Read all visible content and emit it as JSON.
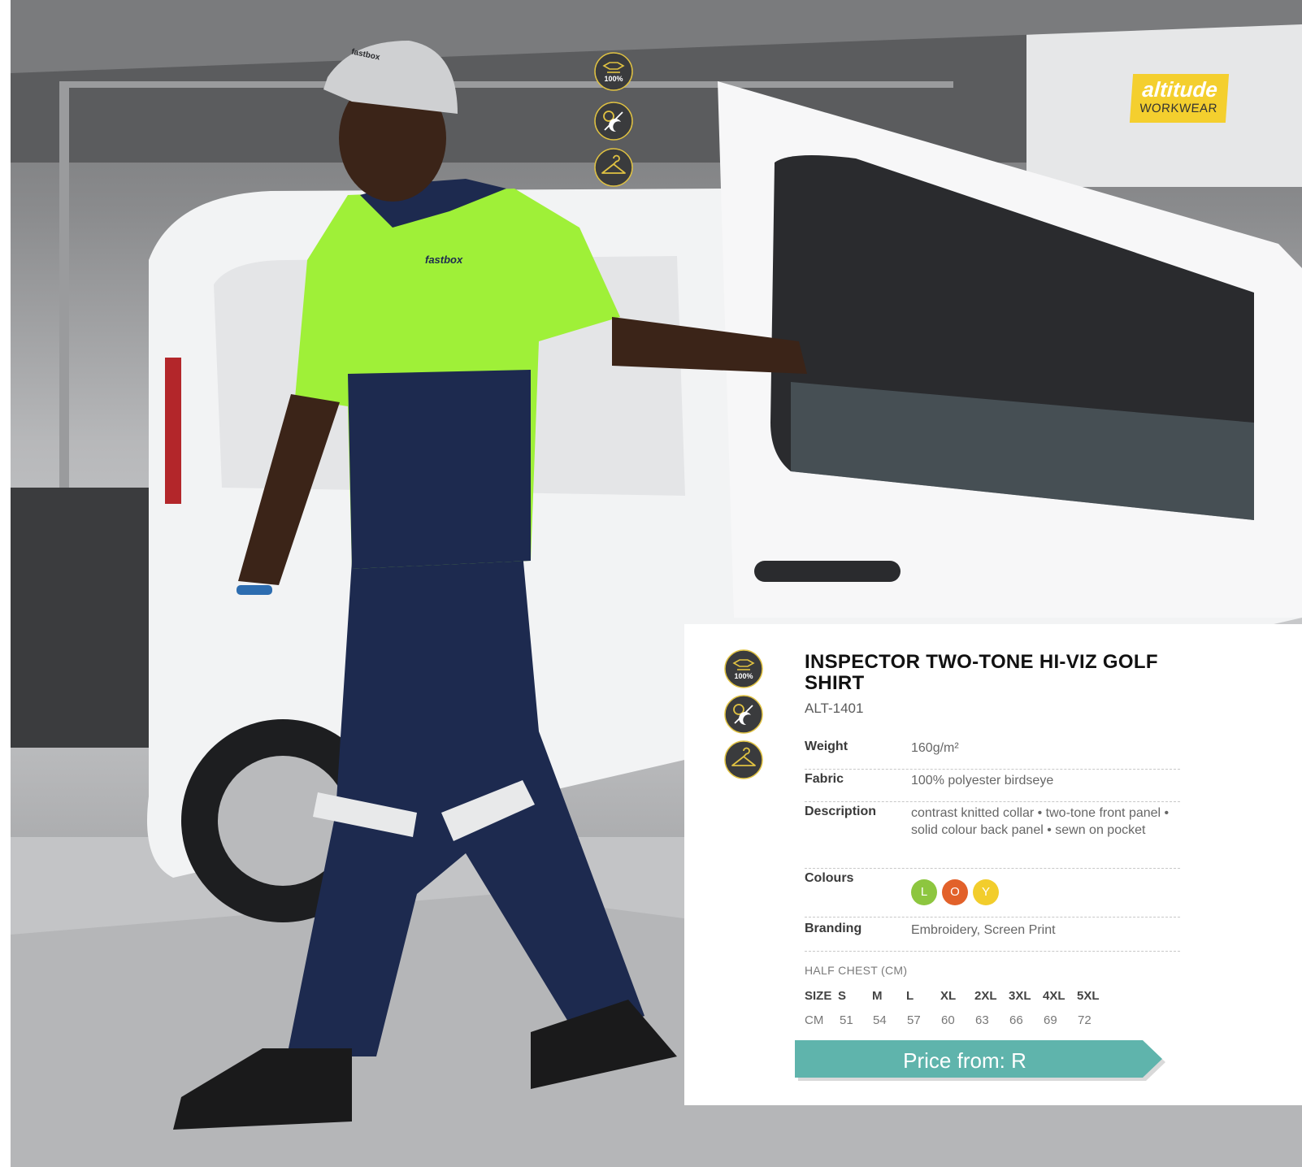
{
  "brand": {
    "logo_top": "altitude",
    "logo_bottom": "WORKWEAR",
    "color": "#f4cf2e"
  },
  "photo_features": [
    {
      "icon": "fabric-100-percent-icon",
      "label": "100%"
    },
    {
      "icon": "sun-moon-icon",
      "label": ""
    },
    {
      "icon": "hanger-icon",
      "label": ""
    }
  ],
  "product": {
    "title": "INSPECTOR TWO-TONE HI-VIZ GOLF SHIRT",
    "code": "ALT-1401",
    "specs": {
      "weight": {
        "label": "Weight",
        "value": "160g/m²"
      },
      "fabric": {
        "label": "Fabric",
        "value": "100% polyester birdseye"
      },
      "description": {
        "label": "Description",
        "value": "contrast knitted collar • two-tone front panel • solid colour back panel • sewn on pocket"
      },
      "colours": {
        "label": "Colours"
      },
      "branding": {
        "label": "Branding",
        "value": "Embroidery, Screen Print"
      }
    },
    "colour_swatches": [
      {
        "code": "L",
        "hex": "#8dc63f"
      },
      {
        "code": "O",
        "hex": "#e2612a"
      },
      {
        "code": "Y",
        "hex": "#f2cd2c"
      }
    ]
  },
  "sizes": {
    "caption": "HALF CHEST (CM)",
    "header_label": "SIZE",
    "cm_label": "CM",
    "size_names": [
      "S",
      "M",
      "L",
      "XL",
      "2XL",
      "3XL",
      "4XL",
      "5XL"
    ],
    "cm_values": [
      "51",
      "54",
      "57",
      "60",
      "63",
      "66",
      "69",
      "72"
    ]
  },
  "price": {
    "label": "Price from: R",
    "color": "#5fb4ac"
  },
  "shirt_logo": {
    "text": "fastbox"
  },
  "cap_logo": {
    "text": "fastbox"
  }
}
